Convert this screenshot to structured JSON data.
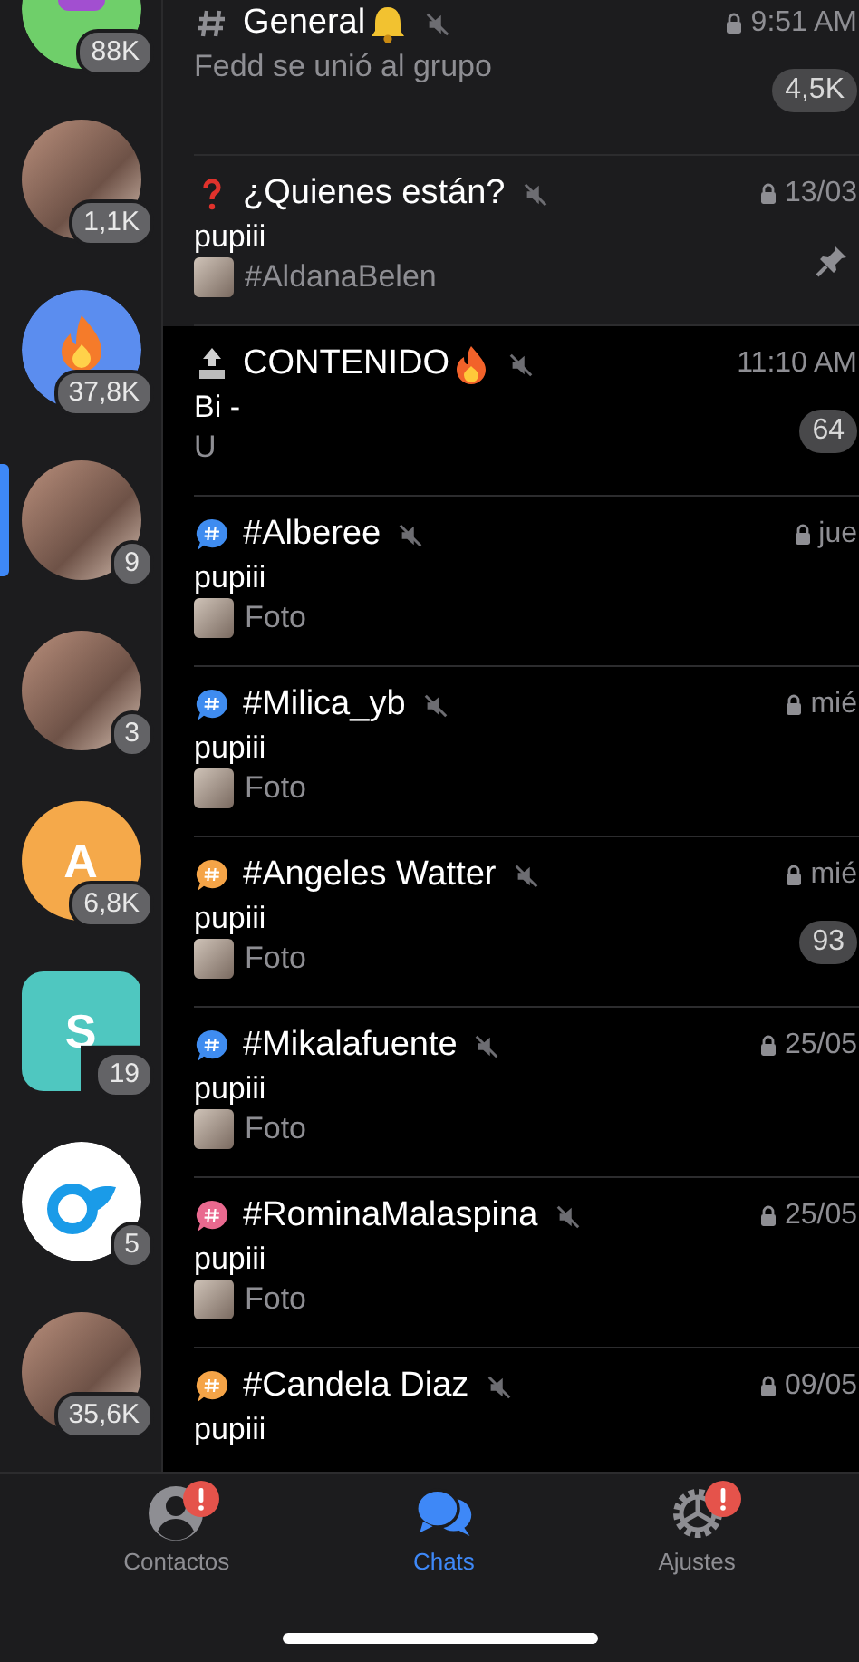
{
  "sidebar": {
    "items": [
      {
        "kind": "app",
        "color": "#6fcf6a",
        "badge": "88K",
        "selected": false
      },
      {
        "kind": "photo",
        "badge": "1,1K",
        "selected": false
      },
      {
        "kind": "fire",
        "color": "#5b8def",
        "badge": "37,8K",
        "selected": false
      },
      {
        "kind": "photo",
        "badge": "9",
        "selected": true
      },
      {
        "kind": "photo",
        "badge": "3",
        "selected": false
      },
      {
        "kind": "letter",
        "color": "#f5a94a",
        "letter": "A",
        "badge": "6,8K",
        "selected": false
      },
      {
        "kind": "square",
        "color": "#4fc7c0",
        "letter": "S",
        "badge": "19",
        "selected": false
      },
      {
        "kind": "logo",
        "color": "#ffffff",
        "badge": "5",
        "selected": false
      },
      {
        "kind": "photo",
        "badge": "35,6K",
        "selected": false
      }
    ]
  },
  "topics": [
    {
      "kind": "hash",
      "title": "General",
      "emoji": {
        "kind": "bell"
      },
      "muted": true,
      "locked": true,
      "time": "9:51 AM",
      "highlighted": true,
      "lines": [
        {
          "text": "Fedd se unió al grupo",
          "kind": "grey"
        }
      ],
      "badge": "4,5K",
      "pinned": false
    },
    {
      "kind": "question",
      "title": "¿Quienes están?",
      "muted": true,
      "locked": true,
      "time": "13/03",
      "highlighted": true,
      "lines": [
        {
          "text": "pupiii",
          "kind": "sender"
        },
        {
          "text": "#AldanaBelen",
          "kind": "media"
        }
      ],
      "pinned": true
    },
    {
      "kind": "top",
      "title": "CONTENIDO",
      "emoji": {
        "kind": "fire"
      },
      "muted": true,
      "locked": false,
      "time": "11:10 AM",
      "highlighted": false,
      "lines": [
        {
          "text": "Bi -",
          "kind": "sender"
        },
        {
          "text": "U",
          "kind": "grey"
        }
      ],
      "badge": "64",
      "pinned": false
    },
    {
      "kind": "bubble",
      "color": "#3f8cf0",
      "title": "#Alberee",
      "muted": true,
      "locked": true,
      "time": "jue",
      "highlighted": false,
      "lines": [
        {
          "text": "pupiii",
          "kind": "sender"
        },
        {
          "text": "Foto",
          "kind": "media"
        }
      ],
      "pinned": false
    },
    {
      "kind": "bubble",
      "color": "#3f8cf0",
      "title": "#Milica_yb",
      "muted": true,
      "locked": true,
      "time": "mié",
      "highlighted": false,
      "lines": [
        {
          "text": "pupiii",
          "kind": "sender"
        },
        {
          "text": "Foto",
          "kind": "media"
        }
      ],
      "pinned": false
    },
    {
      "kind": "bubble",
      "color": "#f5a447",
      "title": "#Angeles Watter",
      "muted": true,
      "locked": true,
      "time": "mié",
      "highlighted": false,
      "lines": [
        {
          "text": "pupiii",
          "kind": "sender"
        },
        {
          "text": "Foto",
          "kind": "media"
        }
      ],
      "badge": "93",
      "pinned": false
    },
    {
      "kind": "bubble",
      "color": "#3f8cf0",
      "title": "#Mikalafuente",
      "muted": true,
      "locked": true,
      "time": "25/05",
      "highlighted": false,
      "lines": [
        {
          "text": "pupiii",
          "kind": "sender"
        },
        {
          "text": "Foto",
          "kind": "media"
        }
      ],
      "pinned": false
    },
    {
      "kind": "bubble",
      "color": "#e9698f",
      "title": "#RominaMalaspina",
      "muted": true,
      "locked": true,
      "time": "25/05",
      "highlighted": false,
      "lines": [
        {
          "text": "pupiii",
          "kind": "sender"
        },
        {
          "text": "Foto",
          "kind": "media"
        }
      ],
      "pinned": false
    },
    {
      "kind": "bubble",
      "color": "#f5a447",
      "title": "#Candela Diaz",
      "muted": true,
      "locked": true,
      "time": "09/05",
      "highlighted": false,
      "lines": [
        {
          "text": "pupiii",
          "kind": "sender"
        }
      ],
      "pinned": false
    }
  ],
  "tab_bar": [
    {
      "kind": "person",
      "label": "Contactos",
      "alert": true,
      "selected": false
    },
    {
      "kind": "chats",
      "label": "Chats",
      "alert": false,
      "selected": true
    },
    {
      "kind": "gear",
      "label": "Ajustes",
      "alert": true,
      "selected": false
    }
  ]
}
